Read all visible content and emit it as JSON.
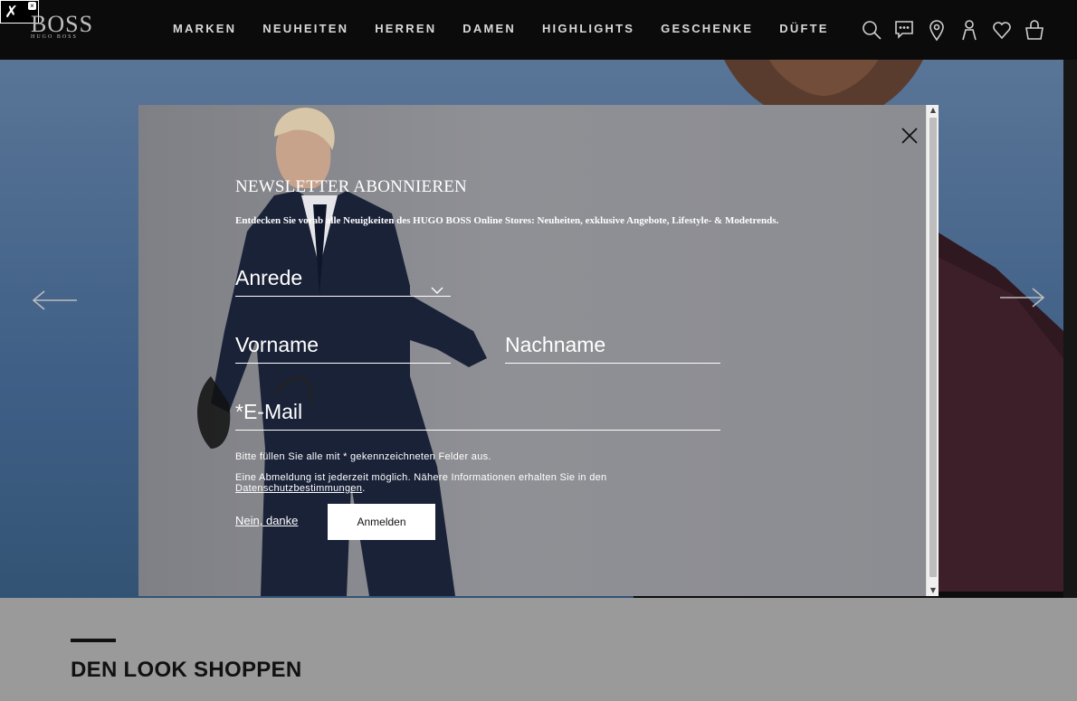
{
  "header": {
    "logo_main": "BOSS",
    "logo_sub": "HUGO BOSS",
    "nav": [
      "MARKEN",
      "NEUHEITEN",
      "HERREN",
      "DAMEN",
      "HIGHLIGHTS",
      "GESCHENKE",
      "DÜFTE"
    ],
    "icons": [
      "search-icon",
      "chat-icon",
      "location-icon",
      "account-icon",
      "wishlist-icon",
      "bag-icon"
    ]
  },
  "tools_badge": {
    "icon": "wrench-icon",
    "close": "×"
  },
  "modal": {
    "title": "NEWSLETTER ABONNIEREN",
    "subtitle": "Entdecken Sie vorab alle Neuigkeiten des HUGO BOSS Online Stores: Neuheiten, exklusive Angebote, Lifestyle- & Modetrends.",
    "anrede_placeholder": "Anrede",
    "vorname_placeholder": "Vorname",
    "nachname_placeholder": "Nachname",
    "email_placeholder": "*E-Mail",
    "required_note": "Bitte füllen Sie alle mit * gekennzeichneten Felder aus.",
    "privacy_text": "Eine Abmeldung ist jederzeit möglich. Nähere Informationen erhalten Sie in den",
    "privacy_link": "Datenschutzbestimmungen",
    "privacy_end": ".",
    "no_thanks": "Nein, danke",
    "submit": "Anmelden"
  },
  "bottom": {
    "heading": "DEN LOOK SHOPPEN"
  },
  "colors": {
    "header_bg": "#0b0b0b",
    "hero_sky": "#5a7fae",
    "modal_bg": "#8a8b90",
    "bottom_bg": "#9a9a9a"
  }
}
